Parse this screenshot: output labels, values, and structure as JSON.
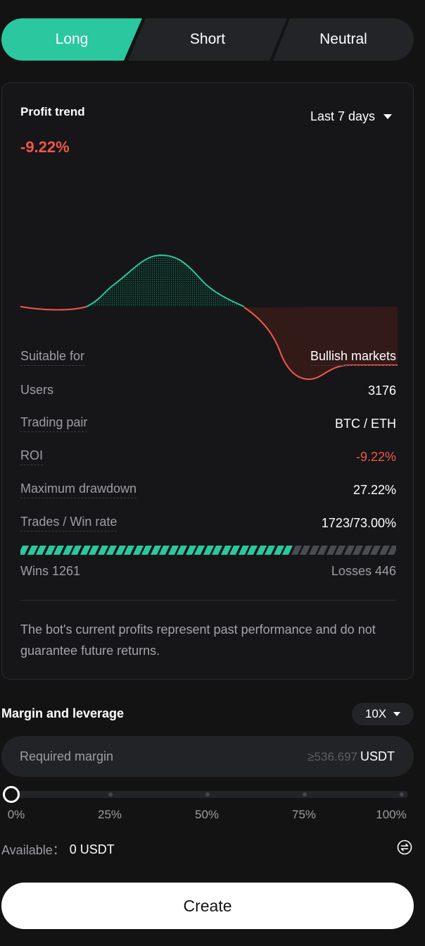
{
  "tabs": [
    {
      "label": "Long",
      "active": true
    },
    {
      "label": "Short",
      "active": false
    },
    {
      "label": "Neutral",
      "active": false
    }
  ],
  "profit_trend": {
    "label": "Profit trend",
    "range": "Last 7 days",
    "value": "-9.22%",
    "colors": {
      "positive": "#2bc79f",
      "negative": "#f0574a"
    }
  },
  "stats": [
    {
      "label": "Suitable for",
      "value": "Bullish markets"
    },
    {
      "label": "Users",
      "value": "3176"
    },
    {
      "label": "Trading pair",
      "value": "BTC / ETH"
    },
    {
      "label": "ROI",
      "value": "-9.22%"
    },
    {
      "label": "Maximum drawdown",
      "value": "27.22%"
    },
    {
      "label": "Trades / Win rate",
      "value": "1723/73.00%"
    }
  ],
  "win_loss": {
    "wins_label": "Wins 1261",
    "losses_label": "Losses 446",
    "win_fraction": 0.73
  },
  "disclaimer": "The bot's current profits represent past performance and do not guarantee future returns.",
  "margin": {
    "title": "Margin and leverage",
    "leverage": "10X",
    "placeholder": "Required margin",
    "min": "≥536.697",
    "currency": "USDT",
    "slider_value": 0,
    "ticks": [
      "0%",
      "25%",
      "50%",
      "75%",
      "100%"
    ]
  },
  "available": {
    "label": "Available：",
    "value": "0 USDT"
  },
  "create_label": "Create"
}
